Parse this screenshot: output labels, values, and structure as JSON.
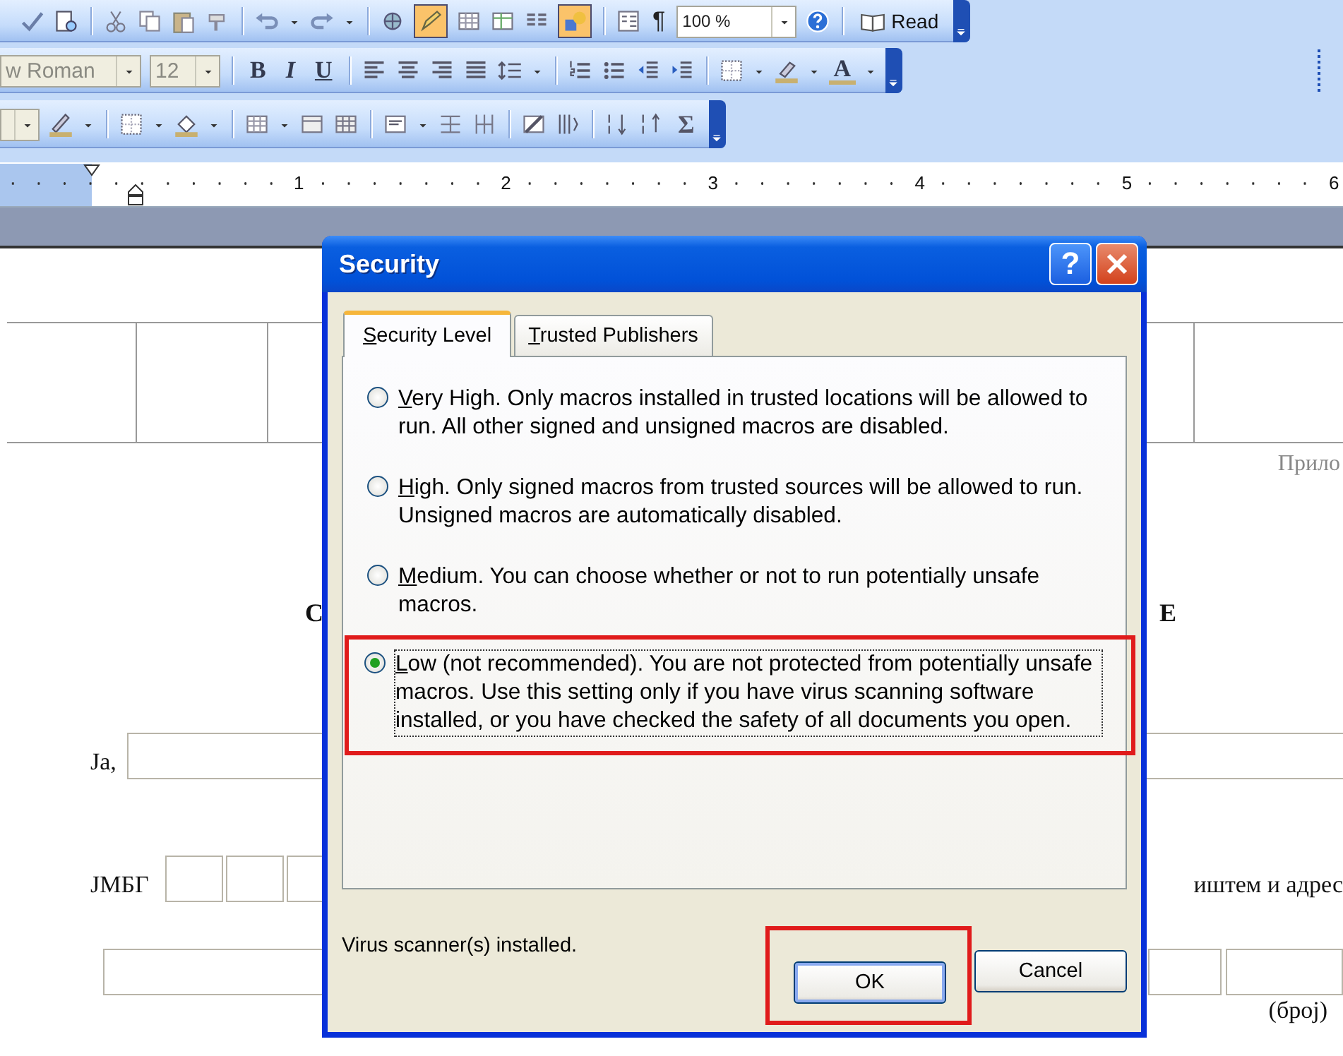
{
  "standard_toolbar": {
    "paragraph_mark": "¶",
    "zoom": "100 %",
    "read_button": "Read"
  },
  "formatting_toolbar": {
    "font": "w Roman",
    "size": "12",
    "bold": "B",
    "italic": "I",
    "underline": "U",
    "font_color": "A"
  },
  "tables_toolbar": {
    "autosum": "Σ"
  },
  "ruler": {
    "numbers": [
      "1",
      "2",
      "3",
      "4",
      "5",
      "6"
    ]
  },
  "document": {
    "attachment_label": "Прило",
    "heading_left": "С",
    "heading_right": "Е",
    "name_label": "Ја,",
    "id_label": "ЈМБГ",
    "address_text": "иштем и адрес",
    "number_caption": "(број)"
  },
  "dialog": {
    "title": "Security",
    "help_button": "?",
    "tabs": [
      {
        "label": "Security Level",
        "selected": true
      },
      {
        "label": "Trusted Publishers",
        "selected": false
      }
    ],
    "options": [
      {
        "label": "Very High. Only macros installed in trusted locations will be allowed to run. All other signed and unsigned macros are disabled.",
        "selected": false,
        "highlighted": false
      },
      {
        "label": "High. Only signed macros from trusted sources will be allowed to run. Unsigned macros are automatically disabled.",
        "selected": false,
        "highlighted": false
      },
      {
        "label": "Medium. You can choose whether or not to run potentially unsafe macros.",
        "selected": false,
        "highlighted": false
      },
      {
        "label": "Low (not recommended). You are not protected from potentially unsafe macros. Use this setting only if you have virus scanning software installed, or you have checked the safety of all documents you open.",
        "selected": true,
        "highlighted": true
      }
    ],
    "status": "Virus scanner(s) installed.",
    "buttons": [
      {
        "label": "OK",
        "default": true,
        "highlighted": true
      },
      {
        "label": "Cancel",
        "default": false,
        "highlighted": false
      }
    ]
  }
}
